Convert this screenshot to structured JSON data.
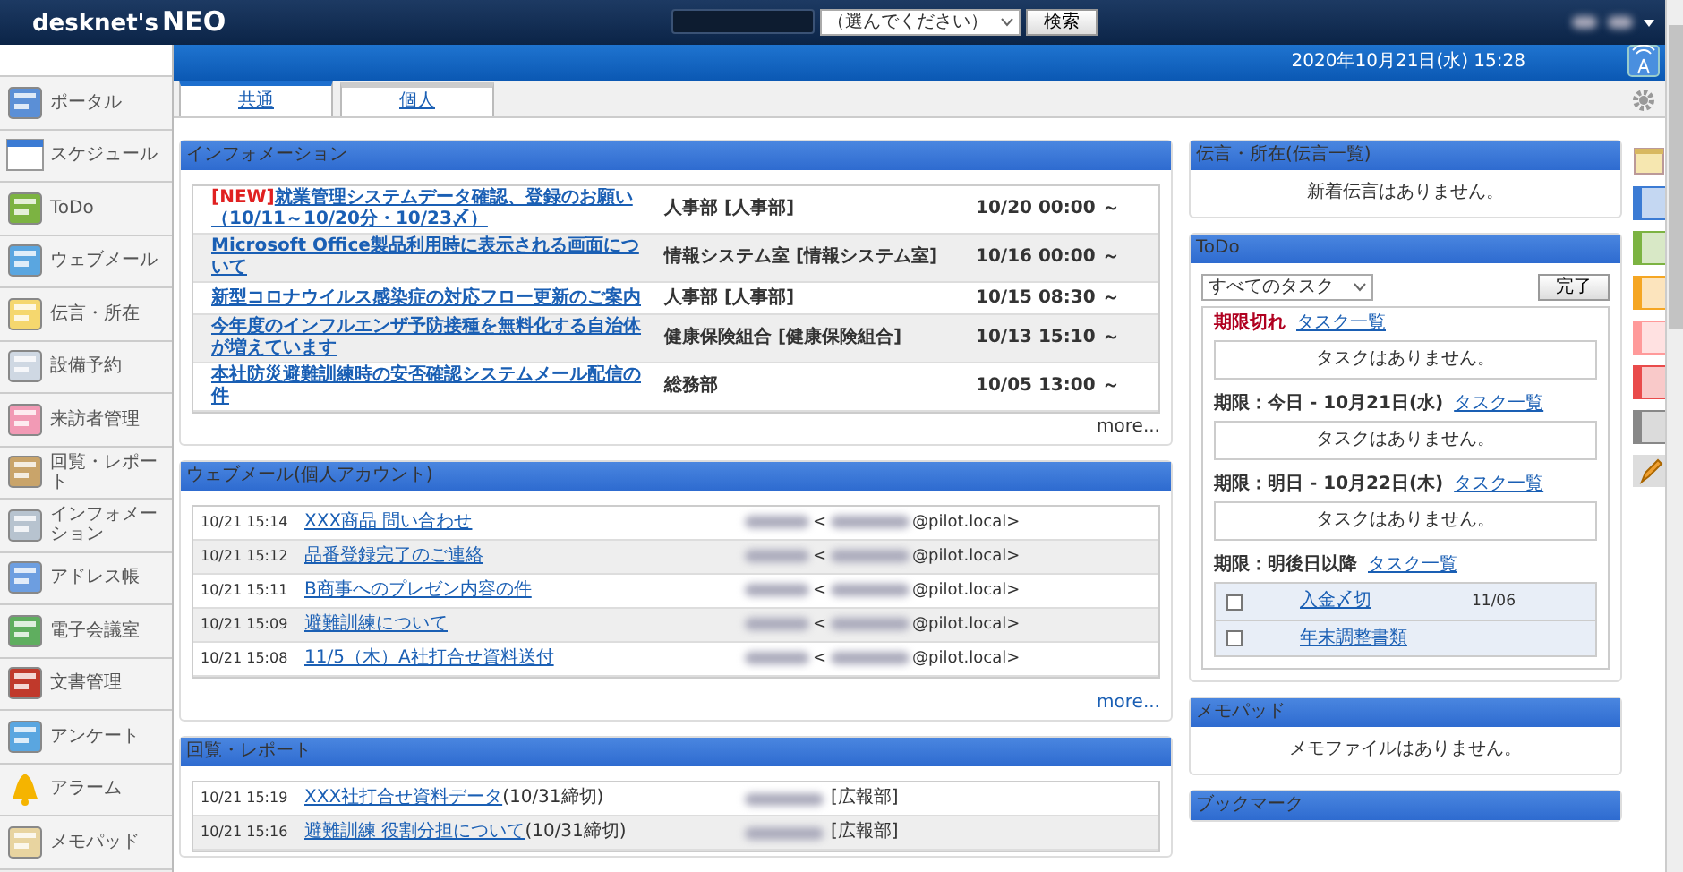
{
  "header": {
    "logo_main": "desknet's",
    "logo_sub": "NEO",
    "search_select": "（選んでください）",
    "search_button": "検索"
  },
  "date_bar": {
    "datetime": "2020年10月21日(水) 15:28"
  },
  "sidebar": {
    "items": [
      {
        "label": "ポータル"
      },
      {
        "label": "スケジュール"
      },
      {
        "label": "ToDo"
      },
      {
        "label": "ウェブメール"
      },
      {
        "label": "伝言・所在"
      },
      {
        "label": "設備予約"
      },
      {
        "label": "来訪者管理"
      },
      {
        "label": "回覧・レポート"
      },
      {
        "label": "インフォメーション"
      },
      {
        "label": "アドレス帳"
      },
      {
        "label": "電子会議室"
      },
      {
        "label": "文書管理"
      },
      {
        "label": "アンケート"
      },
      {
        "label": "アラーム"
      },
      {
        "label": "メモパッド"
      }
    ]
  },
  "tabs": [
    {
      "label": "共通",
      "selected": true
    },
    {
      "label": "個人",
      "selected": false
    }
  ],
  "information": {
    "title": "インフォメーション",
    "rows": [
      {
        "badge": "[NEW]",
        "title": "就業管理システムデータ確認、登録のお願い（10/11～10/20分・10/23〆）",
        "dept": "人事部 [人事部]",
        "date": "10/20 00:00 ～"
      },
      {
        "title": "Microsoft Office製品利用時に表示される画面について",
        "dept": "情報システム室 [情報システム室]",
        "date": "10/16 00:00 ～"
      },
      {
        "title": "新型コロナウイルス感染症の対応フロー更新のご案内",
        "dept": "人事部 [人事部]",
        "date": "10/15 08:30 ～"
      },
      {
        "title": "今年度のインフルエンザ予防接種を無料化する自治体が増えています",
        "dept": "健康保険組合 [健康保険組合]",
        "date": "10/13 15:10 ～"
      },
      {
        "title": "本社防災避難訓練時の安否確認システムメール配信の件",
        "dept": "総務部",
        "date": "10/05 13:00 ～"
      }
    ],
    "more": "more..."
  },
  "webmail": {
    "title": "ウェブメール(個人アカウント)",
    "rows": [
      {
        "time": "10/21 15:14",
        "subject": "XXX商品 問い合わせ",
        "sender_start": "<",
        "sender_end": "@pilot.local>"
      },
      {
        "time": "10/21 15:12",
        "subject": "品番登録完了のご連絡",
        "sender_start": "<",
        "sender_end": "@pilot.local>"
      },
      {
        "time": "10/21 15:11",
        "subject": "B商事へのプレゼン内容の件",
        "sender_start": "<",
        "sender_end": "@pilot.local>"
      },
      {
        "time": "10/21 15:09",
        "subject": "避難訓練について",
        "sender_start": "<",
        "sender_end": "@pilot.local>"
      },
      {
        "time": "10/21 15:08",
        "subject": "11/5（木）A社打合せ資料送付",
        "sender_start": "<",
        "sender_end": "@pilot.local>"
      }
    ],
    "more": "more..."
  },
  "report": {
    "title": "回覧・レポート",
    "rows": [
      {
        "time": "10/21 15:19",
        "title": "XXX社打合せ資料データ",
        "deadline": "(10/31締切)",
        "dept": "[広報部]"
      },
      {
        "time": "10/21 15:16",
        "title": "避難訓練 役割分担について",
        "deadline": "(10/31締切)",
        "dept": "[広報部]"
      }
    ]
  },
  "messages": {
    "title": "伝言・所在(伝言一覧)",
    "empty": "新着伝言はありません。"
  },
  "todo": {
    "title": "ToDo",
    "filter": "すべてのタスク",
    "done_button": "完了",
    "groups": [
      {
        "label": "期限切れ",
        "overdue": true,
        "link": "タスク一覧",
        "empty": "タスクはありません。"
      },
      {
        "label": "期限：今日 - 10月21日(水)",
        "overdue": false,
        "link": "タスク一覧",
        "empty": "タスクはありません。"
      },
      {
        "label": "期限：明日 - 10月22日(木)",
        "overdue": false,
        "link": "タスク一覧",
        "empty": "タスクはありません。"
      },
      {
        "label": "期限：明後日以降",
        "overdue": false,
        "link": "タスク一覧",
        "tasks": [
          {
            "title": "入金〆切",
            "date": "11/06",
            "checked": false
          },
          {
            "title": "年末調整書類",
            "checked": false
          }
        ]
      }
    ]
  },
  "memopad": {
    "title": "メモパッド",
    "empty": "メモファイルはありません。"
  },
  "bookmark": {
    "title": "ブックマーク"
  }
}
